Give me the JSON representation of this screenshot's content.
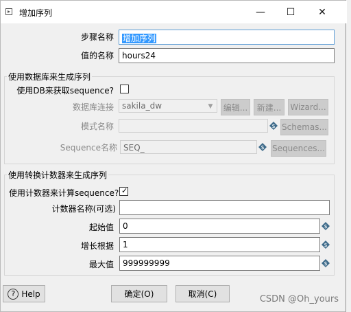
{
  "window": {
    "title": "增加序列",
    "minimize": "—",
    "maximize": "☐",
    "close": "✕"
  },
  "fields": {
    "step_name_label": "步骤名称",
    "step_name_value": "增加序列",
    "value_name_label": "值的名称",
    "value_name_value": "hours24"
  },
  "db_group": {
    "title": "使用数据库来生成序列",
    "use_db_label": "使用DB来获取sequence?",
    "use_db_checked": false,
    "connection_label": "数据库连接",
    "connection_value": "sakila_dw",
    "edit_button": "编辑...",
    "new_button": "新建...",
    "wizard_button": "Wizard...",
    "schema_label": "模式名称",
    "schema_value": "",
    "schemas_button": "Schemas...",
    "sequence_label": "Sequence名称",
    "sequence_value": "SEQ_",
    "sequences_button": "Sequences..."
  },
  "counter_group": {
    "title": "使用转换计数器来生成序列",
    "use_counter_label": "使用计数器来计算sequence?",
    "use_counter_checked": true,
    "counter_name_label": "计数器名称(可选)",
    "counter_name_value": "",
    "start_label": "起始值",
    "start_value": "0",
    "increment_label": "增长根据",
    "increment_value": "1",
    "max_label": "最大值",
    "max_value": "999999999"
  },
  "footer": {
    "help_button": "Help",
    "ok_button": "确定(O)",
    "cancel_button": "取消(C)"
  },
  "watermark": "CSDN @Oh_yours",
  "colors": {
    "variable_icon": "#3e6b8a",
    "focus_border": "#5b9bd5",
    "selection": "#3399ff"
  }
}
